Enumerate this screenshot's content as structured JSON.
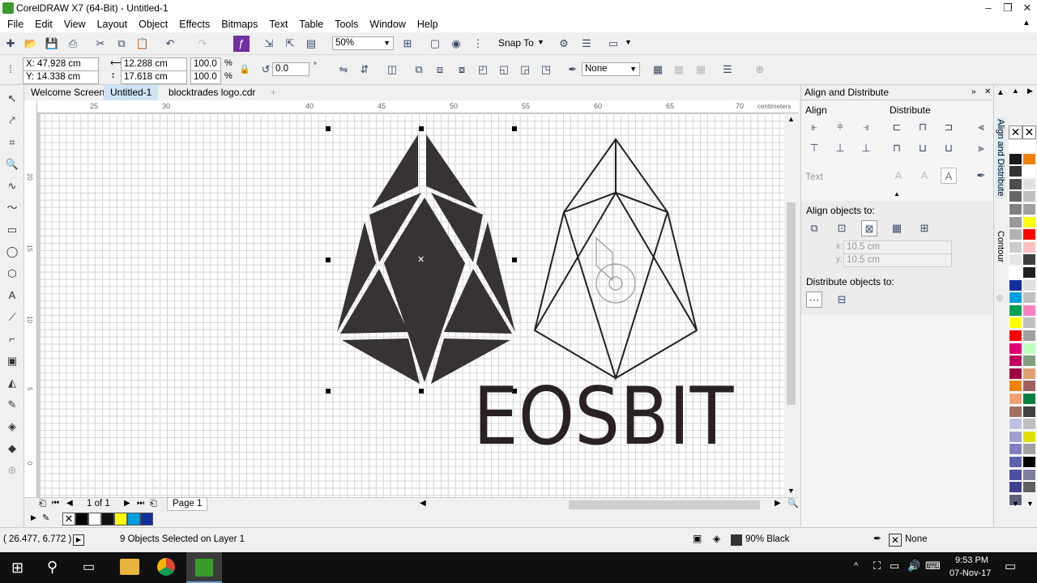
{
  "window": {
    "title": "CorelDRAW X7 (64-Bit) - Untitled-1"
  },
  "menu": [
    "File",
    "Edit",
    "View",
    "Layout",
    "Object",
    "Effects",
    "Bitmaps",
    "Text",
    "Table",
    "Tools",
    "Window",
    "Help"
  ],
  "toolbar": {
    "zoom": "50%",
    "snap_label": "Snap To"
  },
  "props": {
    "x": "X: 47.928 cm",
    "y": "Y: 14.338 cm",
    "w": "12.288 cm",
    "h": "17.618 cm",
    "sx": "100.0",
    "sy": "100.0",
    "pct": "%",
    "angle": "0.0",
    "deg": "°",
    "outline": "None"
  },
  "tabs": [
    "Welcome Screen",
    "Untitled-1",
    "blocktrades logo.cdr"
  ],
  "ruler": {
    "unit": "centimeters",
    "h_ticks": [
      "25",
      "30",
      "40",
      "45",
      "50",
      "55",
      "60",
      "65",
      "70"
    ],
    "v_ticks": [
      "20",
      "15",
      "10",
      "5",
      "0"
    ],
    "v_unit": "centimeters"
  },
  "logo": {
    "text": "EOSBIT"
  },
  "pagebar": {
    "count": "1 of 1",
    "page": "Page 1"
  },
  "status": {
    "coords": "( 26.477, 6.772 )",
    "selection": "9 Objects Selected on Layer 1",
    "fill": "90% Black",
    "outline": "None"
  },
  "docker": {
    "title": "Align and Distribute",
    "align": "Align",
    "distribute": "Distribute",
    "text": "Text",
    "align_to": "Align objects to:",
    "xval": "10.5 cm",
    "yval": "10.5 cm",
    "xlab": "x:",
    "ylab": "y:",
    "dist_to": "Distribute objects to:"
  },
  "dockertabs": {
    "a": "Align and Distribute",
    "b": "Contour"
  },
  "taskbar": {
    "time": "9:53 PM",
    "date": "07-Nov-17"
  },
  "swatches": [
    "#000000",
    "#ffffff",
    "#111111",
    "#ffff00",
    "#00a0e0",
    "#1030a0"
  ],
  "palette_left": [
    "#ffffff",
    "#1a1a1a",
    "#333333",
    "#4d4d4d",
    "#666666",
    "#808080",
    "#999999",
    "#b3b3b3",
    "#cccccc",
    "#e6e6e6",
    "#ffffff",
    "#1030a0",
    "#00a0e0",
    "#00a050",
    "#ffff00",
    "#ff0000",
    "#e0007a",
    "#c00060",
    "#a00040",
    "#f08000",
    "#f0a070",
    "#a07060",
    "#c0c0e0",
    "#a0a0d0",
    "#8080c0",
    "#6060b0",
    "#5050a0",
    "#404090",
    "#606080"
  ],
  "palette_right": [
    "#ffffff",
    "#f08000",
    "#ffffff",
    "#e0e0e0",
    "#c0c0c0",
    "#a0a0a0",
    "#ffff00",
    "#ff0000",
    "#ffc0c0",
    "#404040",
    "#202020",
    "#e0e0e0",
    "#c0c0c0",
    "#ff80c0",
    "#c0c0c0",
    "#a0a0a0",
    "#c0ffc0",
    "#80a080",
    "#e0a070",
    "#a06060",
    "#008040",
    "#404040",
    "#c0c0c0",
    "#e0e000",
    "#a0a0a0",
    "#000000",
    "#8080a0",
    "#606060"
  ]
}
